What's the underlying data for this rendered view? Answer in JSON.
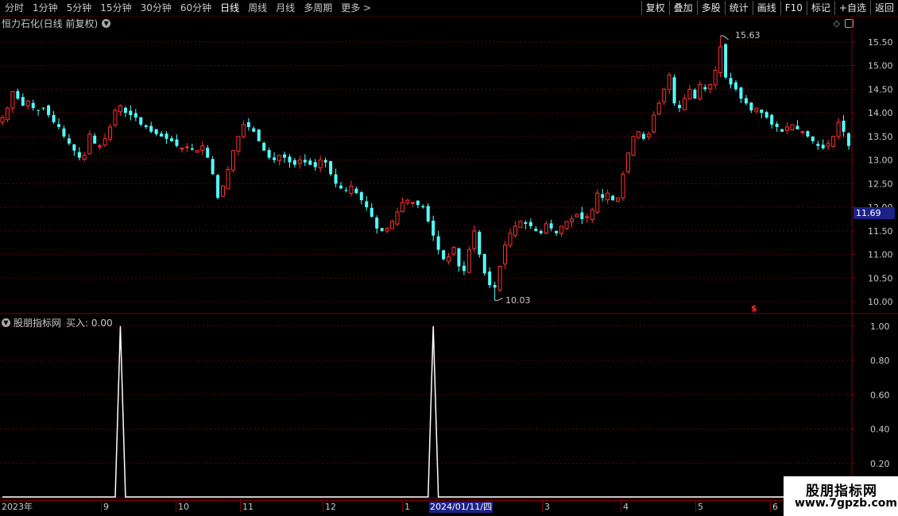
{
  "toolbar": {
    "periods": [
      "分时",
      "1分钟",
      "5分钟",
      "15分钟",
      "30分钟",
      "60分钟",
      "日线",
      "周线",
      "月线",
      "多周期",
      "更多 >"
    ],
    "active": "日线",
    "buttons": [
      "复权",
      "叠加",
      "多股",
      "统计",
      "画线",
      "F10",
      "标记",
      "+自选",
      "返回"
    ]
  },
  "chart_title": "恒力石化(日线 前复权)",
  "indicator_title": "股朋指标网",
  "indicator_readout": "买入: 0.00",
  "price_axis": [
    "15.50",
    "15.00",
    "14.50",
    "14.00",
    "13.50",
    "13.00",
    "12.50",
    "12.00",
    "11.50",
    "11.00",
    "10.50",
    "10.00"
  ],
  "current_price": "11.69",
  "high_label": "15.63",
  "low_label": "10.03",
  "marker": "$",
  "indicator_axis": [
    "1.00",
    "0.80",
    "0.60",
    "0.40",
    "0.20"
  ],
  "dates": [
    "2023年",
    "9",
    "10",
    "11",
    "12",
    "1",
    "2024/01/11/四",
    "3",
    "4",
    "5",
    "6"
  ],
  "watermark": {
    "line1": "股朋指标网",
    "line2": "www.7gpzb.com"
  },
  "colors": {
    "up": "#ff3232",
    "down": "#54ffff",
    "grid": "#800000",
    "background": "#000000"
  },
  "chart_data": {
    "type": "candlestick",
    "title": "恒力石化(日线 前复权)",
    "ylim": [
      9.8,
      15.75
    ],
    "closes": [
      13.9,
      14.1,
      14.45,
      14.3,
      14.15,
      14.25,
      14.1,
      14.05,
      14.1,
      13.95,
      13.8,
      13.7,
      13.5,
      13.35,
      13.2,
      13.05,
      13.1,
      13.55,
      13.35,
      13.3,
      13.45,
      13.7,
      14.05,
      14.15,
      14.0,
      13.95,
      13.9,
      13.75,
      13.7,
      13.6,
      13.55,
      13.5,
      13.45,
      13.4,
      13.3,
      13.25,
      13.28,
      13.22,
      13.2,
      13.3,
      13.05,
      12.7,
      12.2,
      12.45,
      12.8,
      13.2,
      13.5,
      13.75,
      13.7,
      13.6,
      13.4,
      13.2,
      13.05,
      13.0,
      13.1,
      13.05,
      12.95,
      12.9,
      13.0,
      12.95,
      12.9,
      12.85,
      13.0,
      12.95,
      12.7,
      12.5,
      12.4,
      12.35,
      12.45,
      12.3,
      12.15,
      12.0,
      11.8,
      11.55,
      11.5,
      11.55,
      11.7,
      11.9,
      12.1,
      12.15,
      12.1,
      12.05,
      12.0,
      11.7,
      11.4,
      11.1,
      10.9,
      10.95,
      11.15,
      10.75,
      10.65,
      11.1,
      11.5,
      11.0,
      10.6,
      10.35,
      10.3,
      10.75,
      11.2,
      11.45,
      11.6,
      11.7,
      11.65,
      11.6,
      11.5,
      11.45,
      11.65,
      11.55,
      11.45,
      11.6,
      11.7,
      11.75,
      11.85,
      11.75,
      11.8,
      11.95,
      12.3,
      12.2,
      12.3,
      12.15,
      12.2,
      12.7,
      13.15,
      13.5,
      13.6,
      13.45,
      13.55,
      13.95,
      14.2,
      14.5,
      14.8,
      14.2,
      14.1,
      14.3,
      14.5,
      14.3,
      14.6,
      14.5,
      14.6,
      14.9,
      15.4,
      14.75,
      14.6,
      14.5,
      14.3,
      14.2,
      14.05,
      14.1,
      14.0,
      13.9,
      13.75,
      13.7,
      13.6,
      13.7,
      13.75,
      13.65,
      13.6,
      13.5,
      13.4,
      13.3,
      13.25,
      13.35,
      13.5,
      13.8,
      13.6,
      13.3
    ],
    "high": 15.63,
    "low": 10.03,
    "last": 11.69
  },
  "indicator_data": {
    "name": "买入",
    "ylim": [
      0,
      1.05
    ],
    "spikes_at_index": [
      23,
      84
    ]
  }
}
